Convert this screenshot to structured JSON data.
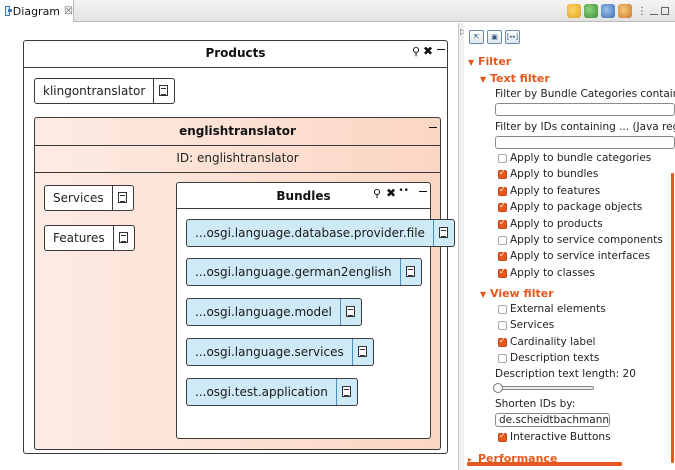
{
  "tab": {
    "label": "Diagram",
    "close": "☒"
  },
  "products": {
    "title": "Products",
    "translator_item": "klingontranslator"
  },
  "english": {
    "title": "englishtranslator",
    "id_text": "ID: englishtranslator",
    "services_label": "Services",
    "features_label": "Features"
  },
  "bundles": {
    "title": "Bundles",
    "items": [
      "...osgi.language.database.provider.file",
      "...osgi.language.german2english",
      "...osgi.language.model",
      "...osgi.language.services",
      "...osgi.test.application"
    ]
  },
  "panel": {
    "filter": {
      "title": "Filter",
      "text_filter": {
        "title": "Text filter",
        "bundle_categories_label": "Filter by Bundle Categories containing ...",
        "ids_label": "Filter by IDs containing ... (Java regex):",
        "options": [
          {
            "label": "Apply to bundle categories",
            "checked": false
          },
          {
            "label": "Apply to bundles",
            "checked": true
          },
          {
            "label": "Apply to features",
            "checked": true
          },
          {
            "label": "Apply to package objects",
            "checked": true
          },
          {
            "label": "Apply to products",
            "checked": true
          },
          {
            "label": "Apply to service components",
            "checked": false
          },
          {
            "label": "Apply to service interfaces",
            "checked": true
          },
          {
            "label": "Apply to classes",
            "checked": true
          }
        ]
      },
      "view_filter": {
        "title": "View filter",
        "options": [
          {
            "label": "External elements",
            "checked": false
          },
          {
            "label": "Services",
            "checked": false
          },
          {
            "label": "Cardinality label",
            "checked": true
          },
          {
            "label": "Description texts",
            "checked": false
          }
        ],
        "desc_length_label": "Description text length: 20",
        "desc_length_value": 20,
        "shorten_label": "Shorten IDs by:",
        "shorten_value": "de.scheidtbachmann.",
        "interactive_buttons": {
          "label": "Interactive Buttons",
          "checked": true
        }
      }
    },
    "performance": {
      "title": "Performance"
    }
  },
  "colors": {
    "accent": "#e5581d",
    "node_orange": "#fbd6c4",
    "node_blue": "#cfeaf7"
  }
}
